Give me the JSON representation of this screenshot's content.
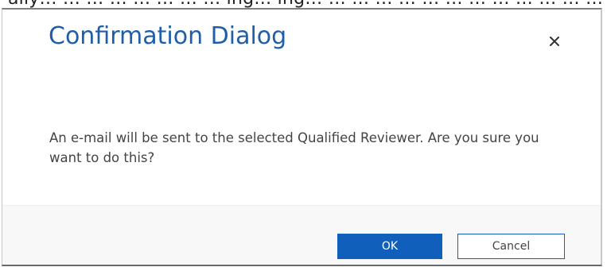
{
  "background": {
    "partial_text": "ally… … … … … … … … ing… ing… … … … … … … … … … … … … … … … … … … … … … … … … … … … … … … … …"
  },
  "dialog": {
    "title": "Confirmation Dialog",
    "close_icon": "close-icon",
    "message": "An e-mail will be sent to the selected Qualified Reviewer. Are you sure you want to do this?",
    "buttons": {
      "ok_label": "OK",
      "cancel_label": "Cancel"
    }
  },
  "colors": {
    "title": "#1f5ea9",
    "primary_button": "#1060bb",
    "footer_background": "#f8f8f8",
    "message_text": "#444444"
  }
}
